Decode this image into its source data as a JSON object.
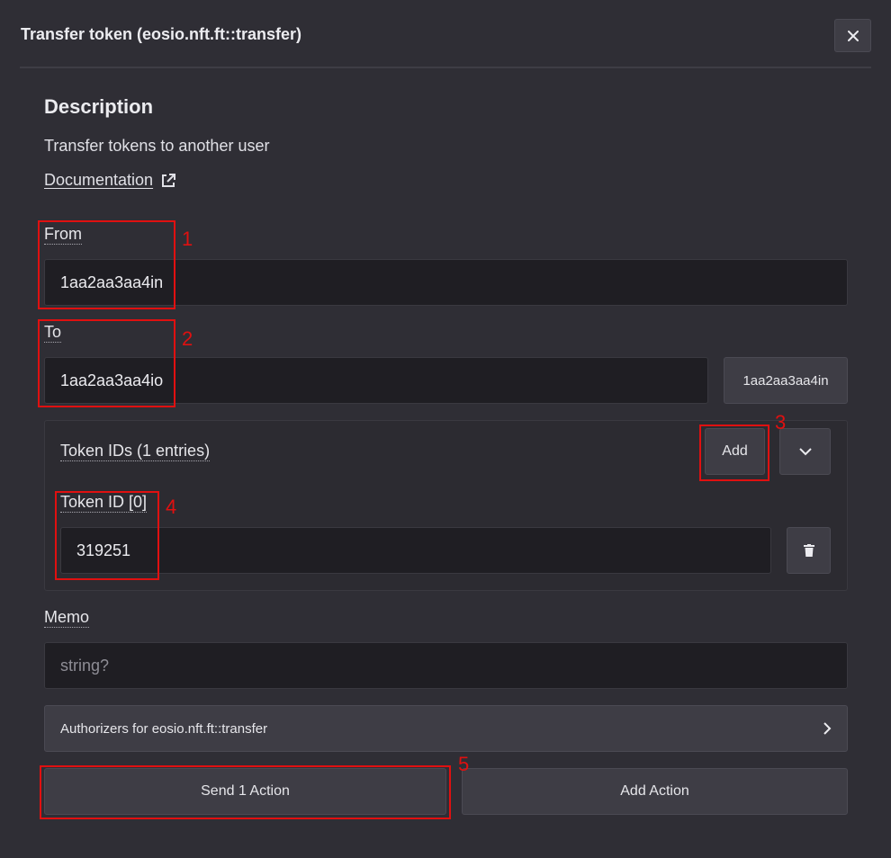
{
  "dialog": {
    "title": "Transfer token (eosio.nft.ft::transfer)",
    "close_icon": "close-icon"
  },
  "description": {
    "heading": "Description",
    "text": "Transfer tokens to another user",
    "doc_link": "Documentation",
    "doc_icon": "external-link-icon"
  },
  "fields": {
    "from": {
      "label": "From",
      "value": "1aa2aa3aa4in"
    },
    "to": {
      "label": "To",
      "value": "1aa2aa3aa4io",
      "suggestion": "1aa2aa3aa4in"
    },
    "token_ids": {
      "label": "Token IDs (1 entries)",
      "add_label": "Add",
      "items": [
        {
          "label": "Token ID [0]",
          "value": "319251"
        }
      ]
    },
    "memo": {
      "label": "Memo",
      "placeholder": "string?"
    }
  },
  "authorizers": {
    "label": "Authorizers for eosio.nft.ft::transfer"
  },
  "actions": {
    "send_label": "Send 1 Action",
    "add_label": "Add Action"
  },
  "annotations": [
    "1",
    "2",
    "3",
    "4",
    "5"
  ],
  "colors": {
    "background": "#2f2e35",
    "input_bg": "#1f1e23",
    "button_bg": "#3e3d45",
    "annotation": "#e01010"
  }
}
